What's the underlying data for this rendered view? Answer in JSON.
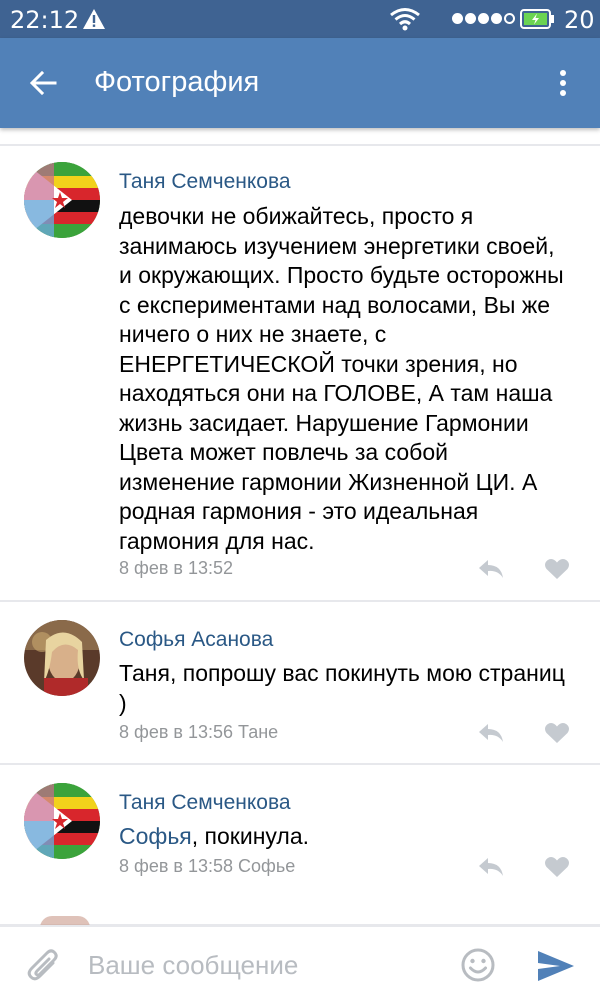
{
  "status_bar": {
    "time": "22:12",
    "battery_level": "20"
  },
  "app_bar": {
    "title": "Фотография"
  },
  "comments": [
    {
      "author": "Таня Семченкова",
      "text": "девочки не обижайтесь, просто я занимаюсь изучением энергетики своей, и окружающих. Просто будьте осторожны с експериментами над волосами, Вы же ничего о них не знаете, с ЕНЕРГЕТИЧЕСКОЙ точки зрения, но находяться они на ГОЛОВЕ, А там наша жизнь засидает. Нарушение Гармонии Цвета может повлечь за собой изменение гармонии Жизненной ЦИ. А родная гармония - это идеальная гармония для нас.",
      "meta": "8 фев в 13:52"
    },
    {
      "author": "Софья Асанова",
      "text": "Таня, попрошу вас покинуть мою страниц )",
      "meta": "8 фев в 13:56 Тане"
    },
    {
      "author": "Таня Семченкова",
      "mention": "Софья",
      "text": ", покинула.",
      "meta": "8 фев в 13:58 Софье"
    }
  ],
  "composer": {
    "placeholder": "Ваше сообщение",
    "value": ""
  },
  "colors": {
    "status_bar": "#3f6392",
    "app_bar": "#5181b8",
    "author_link": "#2a5885",
    "meta_text": "#939699",
    "icon_gray": "#c5cad0",
    "send_blue": "#5181b8"
  }
}
